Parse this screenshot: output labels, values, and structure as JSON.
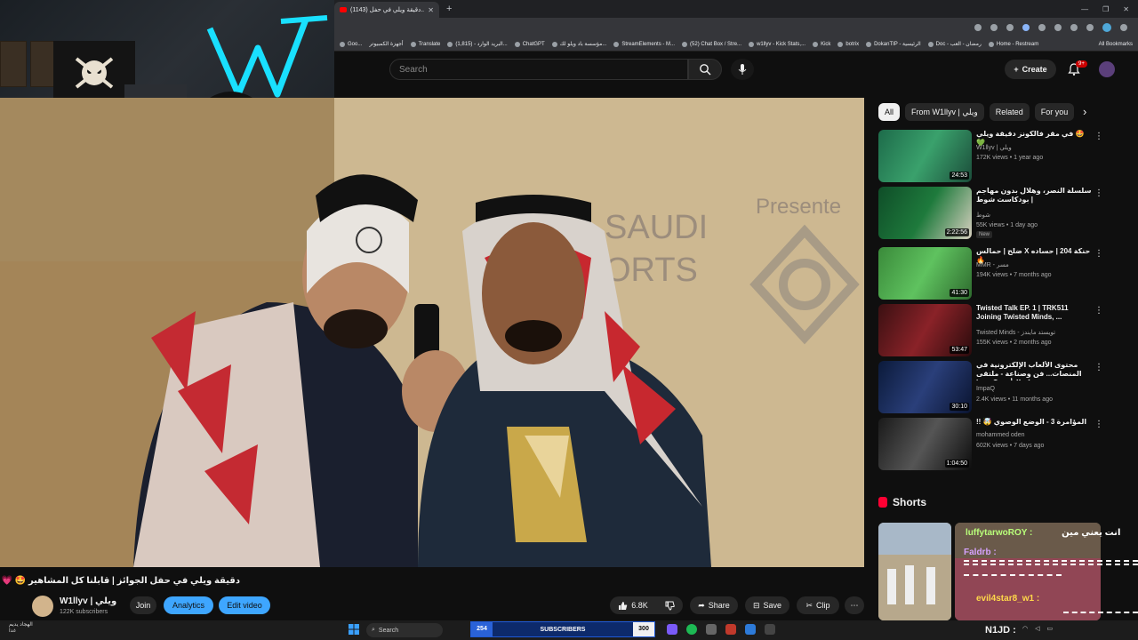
{
  "browser": {
    "tab_title": "(1143) دقيقة ويلي في حفل...",
    "bookmarks": [
      "Goo...",
      "أجهزة الكمبيوتر",
      "Translate",
      "البريد الوارد - (1,815)...",
      "ChatGPT",
      "مؤسسة باد ويلو لك...",
      "StreamElements - M...",
      "(52) Chat Box / Stre...",
      "w1llyv - Kick Stats,...",
      "Kick",
      "botrix",
      "DokanTIP - الرئيسية",
      "Doc - رمضان - العب",
      "Home - Restream"
    ],
    "all_bookmarks": "All Bookmarks"
  },
  "header": {
    "search_placeholder": "Search",
    "create_label": "Create",
    "notifications_badge": "9+"
  },
  "video": {
    "title": "دقيقة ويلي في حفل الجوائز | قابلنا كل المشاهير 🤩 💗",
    "channel_name": "W1llyv | ويلي",
    "subscribers": "122K subscribers",
    "join": "Join",
    "analytics": "Analytics",
    "edit_video": "Edit video",
    "likes": "6.8K",
    "share": "Share",
    "save": "Save",
    "clip": "Clip"
  },
  "chips": [
    "All",
    "From W1llyv | ويلي",
    "Related",
    "For you"
  ],
  "recommendations": [
    {
      "title": "🤩 في مقر فالكونز دقيقة ويلي 💚",
      "channel": "W1llyv | ويلي",
      "meta": "172K views • 1 year ago",
      "duration": "24:53",
      "is_new": ""
    },
    {
      "title": "سلسلة النصر، وهلال بدون مهاجم | بودكاست شوط",
      "channel": "شوط",
      "meta": "55K views • 1 day ago",
      "duration": "2:22:56",
      "is_new": "New"
    },
    {
      "title": "حنكة 204 | حساده X ضلّح | حمالس 🔥",
      "channel": "MMR - مسر",
      "meta": "194K views • 7 months ago",
      "duration": "41:30",
      "is_new": ""
    },
    {
      "title": "Twisted Talk EP. 1 | TRK511 Joining Twisted Minds, ...",
      "channel": "Twisted Minds - تويستد مايندز",
      "meta": "155K views • 2 months ago",
      "duration": "53:47",
      "is_new": ""
    },
    {
      "title": "محتوى الألعاب الإلكترونية في المنصات... فن وصناعة - ملتقى صناع التأثير ImpaQ",
      "channel": "ImpaQ",
      "meta": "2.4K views • 11 months ago",
      "duration": "30:10",
      "is_new": ""
    },
    {
      "title": "المؤامرة 3 - الوضع الوصوي 🤯 !!",
      "channel": "mohammed oden",
      "meta": "602K views • 7 days ago",
      "duration": "1:04:50",
      "is_new": ""
    }
  ],
  "shorts_label": "Shorts",
  "chat": [
    {
      "user": "luffytarwoROY :",
      "text": "انت يعني مين"
    },
    {
      "user": "Faldrb :",
      "text": ""
    },
    {
      "user": "evil4star8_w1 :",
      "text": ""
    }
  ],
  "taskbar": {
    "weather_line1": "الهجاد يديم",
    "weather_line2": "غدا",
    "search": "Search",
    "subs_current": "254",
    "subs_label": "SUBSCRIBERS",
    "subs_goal": "300",
    "streamer": "N1JD :"
  }
}
